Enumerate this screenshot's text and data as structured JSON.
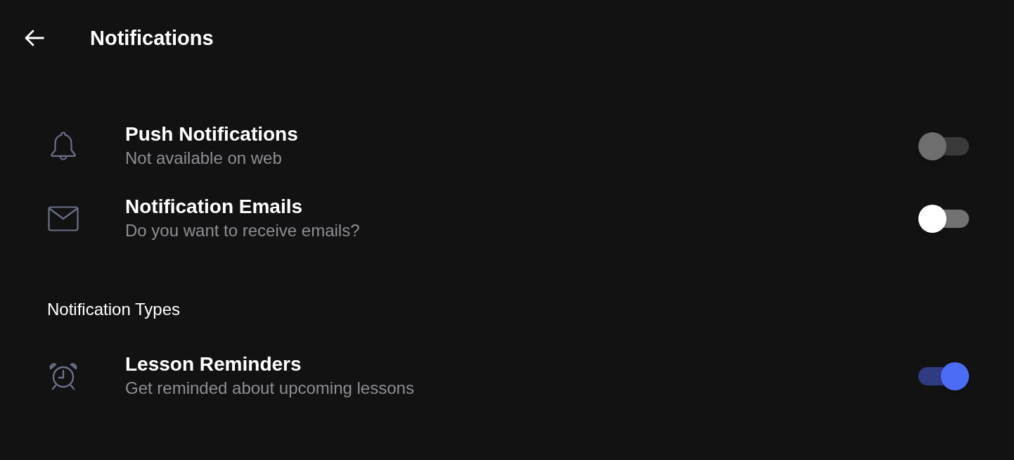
{
  "header": {
    "title": "Notifications"
  },
  "settings": [
    {
      "title": "Push Notifications",
      "subtitle": "Not available on web",
      "on": false,
      "disabled": true
    },
    {
      "title": "Notification Emails",
      "subtitle": "Do you want to receive emails?",
      "on": false,
      "disabled": false
    }
  ],
  "notification_types": {
    "heading": "Notification Types",
    "rows": [
      {
        "title": "Lesson Reminders",
        "subtitle": "Get reminded about upcoming lessons",
        "on": true,
        "disabled": false
      }
    ]
  }
}
